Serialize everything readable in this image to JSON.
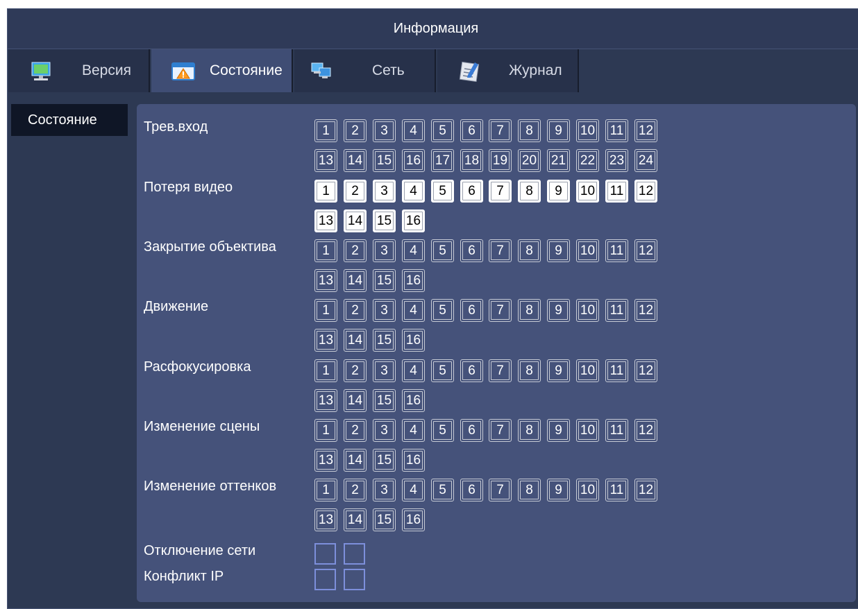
{
  "window": {
    "title": "Информация"
  },
  "tabs": [
    {
      "label": "Версия",
      "icon": "monitor-icon",
      "active": false
    },
    {
      "label": "Состояние",
      "icon": "warning-window-icon",
      "active": true
    },
    {
      "label": "Сеть",
      "icon": "network-icon",
      "active": false
    },
    {
      "label": "Журнал",
      "icon": "log-notepad-icon",
      "active": false
    }
  ],
  "sidebar": {
    "items": [
      {
        "label": "Состояние",
        "active": true
      }
    ]
  },
  "status": {
    "rows": [
      {
        "label": "Трев.вход",
        "channels": 24,
        "active": []
      },
      {
        "label": "Потеря видео",
        "channels": 16,
        "active": [
          1,
          2,
          3,
          4,
          5,
          6,
          7,
          8,
          9,
          10,
          11,
          12,
          13,
          14,
          15,
          16
        ]
      },
      {
        "label": "Закрытие объектива",
        "channels": 16,
        "active": []
      },
      {
        "label": "Движение",
        "channels": 16,
        "active": []
      },
      {
        "label": "Расфокусировка",
        "channels": 16,
        "active": []
      },
      {
        "label": "Изменение сцены",
        "channels": 16,
        "active": []
      },
      {
        "label": "Изменение оттенков",
        "channels": 16,
        "active": []
      }
    ],
    "network_rows": [
      {
        "label": "Отключение сети",
        "boxes": 2
      },
      {
        "label": "Конфликт IP",
        "boxes": 2
      }
    ]
  },
  "colors": {
    "background": "#2d3953",
    "panel": "#45527a",
    "active_tab": "#3f4d74",
    "sidebar_active": "#0f1626",
    "channel_on": "#ffffff",
    "network_box_border": "#7d8fdb"
  }
}
